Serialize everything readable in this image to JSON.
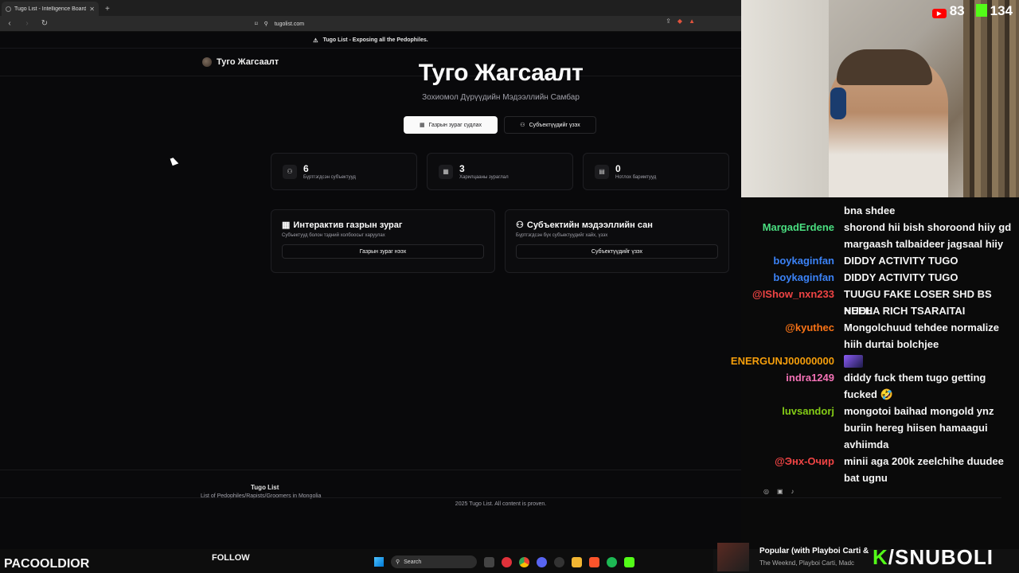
{
  "browser": {
    "tab_title": "Tugo List - Intelligence Board",
    "tab_close": "✕",
    "new_tab": "+",
    "url": "tugolist.com"
  },
  "site": {
    "banner": "Tugo List - Exposing all the Pedophiles.",
    "header_name": "Туго Жагсаалт",
    "hero_title": "Туго Жагсаалт",
    "hero_subtitle": "Зохиомол Дүрүүдийн Мэдээллийн Самбар",
    "btn_map": "Газрын зураг судлах",
    "btn_subjects": "Субъектүүдийг үзэх",
    "stats": [
      {
        "value": "6",
        "label": "Бүртгэгдсэн субъектууд",
        "icon": "users-icon"
      },
      {
        "value": "3",
        "label": "Харилцааны зураглал",
        "icon": "map-icon"
      },
      {
        "value": "0",
        "label": "Нотлох баримтууд",
        "icon": "document-icon"
      }
    ],
    "cards": [
      {
        "title": "Интерактив газрын зураг",
        "subtitle": "Субъектууд болон тэдний холбоосыг харуулах",
        "button": "Газрын зураг нээх"
      },
      {
        "title": "Субъектийн мэдээллийн сан",
        "subtitle": "Бүртгэгдсэн бүх субъектуудийг хайх, үзэх",
        "button": "Субъектүүдийг үзэх"
      }
    ],
    "footer_name": "Tugo List",
    "footer_desc": "List of Pedophiles/Rapists/Groomers in Mongolia",
    "footer_copy": "2025 Tugo List. All content is proven."
  },
  "stream": {
    "youtube_count": "83",
    "kick_count": "134",
    "streamer": "PACOOLDIOR",
    "follow": "FOLLOW",
    "brand": "/SNUBOLI",
    "now_playing_title": "Popular (with Playboi Carti &",
    "now_playing_artist": "The Weeknd, Playboi Carti, Madc",
    "search_label": "Search"
  },
  "chat": [
    {
      "user": "",
      "color": "#f5f5f5",
      "lines": [
        "bna shdee"
      ]
    },
    {
      "user": "MargadErdene",
      "color": "#4ade80",
      "lines": [
        "shorond hii bish shoroond hiiy gd",
        "margaash talbaideer jagsaal hiiy"
      ]
    },
    {
      "user": "boykaginfan",
      "color": "#3b82f6",
      "lines": [
        "DIDDY ACTIVITY TUGO"
      ]
    },
    {
      "user": "boykaginfan",
      "color": "#3b82f6",
      "lines": [
        "DIDDY ACTIVITY TUGO"
      ]
    },
    {
      "user": "@IShow_nxn233",
      "color": "#ef4444",
      "lines": [
        "TUUGU FAKE LOSER SHD BS NEEH",
        "HUDLA RICH TSARAITAI"
      ]
    },
    {
      "user": "@kyuthec",
      "color": "#f97316",
      "lines": [
        "Mongolchuud tehdee normalize",
        "hiih durtai bolchjee"
      ]
    },
    {
      "user": "ENERGUNJ00000000",
      "color": "#f59e0b",
      "lines": [
        ""
      ]
    },
    {
      "user": "indra1249",
      "color": "#f472b6",
      "lines": [
        "diddy fuck them tugo getting",
        "fucked 🤣"
      ]
    },
    {
      "user": "luvsandorj",
      "color": "#84cc16",
      "lines": [
        "mongotoi baihad mongold ynz",
        "buriin hereg hiisen hamaagui",
        "avhiimda"
      ]
    },
    {
      "user": "@Энх-Очир",
      "color": "#ef4444",
      "lines": [
        "minii aga 200k zeelchihe duudee",
        "bat ugnu"
      ]
    }
  ]
}
